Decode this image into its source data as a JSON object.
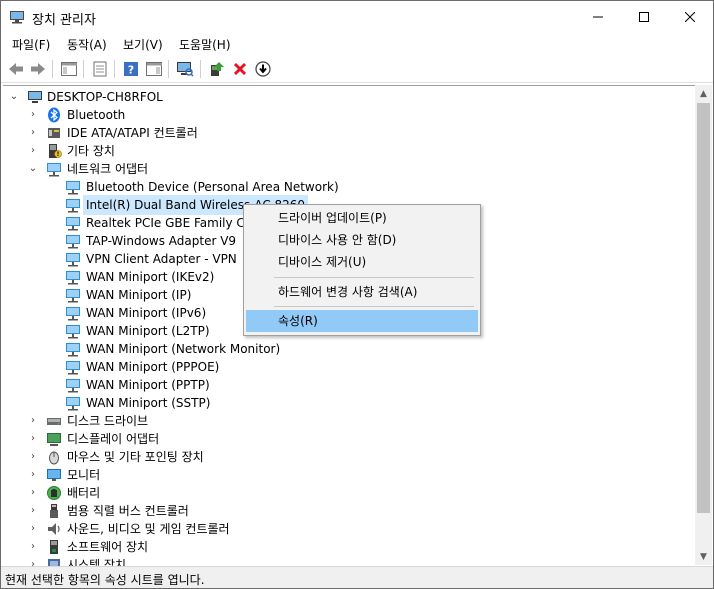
{
  "window": {
    "title": "장치 관리자",
    "app_icon": "device-manager-icon"
  },
  "menu": [
    "파일(F)",
    "동작(A)",
    "보기(V)",
    "도움말(H)"
  ],
  "toolbar": {
    "icons": [
      "back-arrow-icon",
      "forward-arrow-icon",
      "show-hide-tree-icon",
      "properties-sheet-icon",
      "help-icon",
      "action-pane-icon",
      "scan-hardware-icon",
      "update-driver-icon",
      "uninstall-device-icon",
      "download-driver-icon"
    ]
  },
  "tree": {
    "root": "DESKTOP-CH8RFOL",
    "bluetooth": "Bluetooth",
    "ide": "IDE ATA/ATAPI 컨트롤러",
    "other": "기타 장치",
    "network": "네트워크 어댑터",
    "net_children": [
      "Bluetooth Device (Personal Area Network)",
      "Intel(R) Dual Band Wireless-AC 8260",
      "Realtek PCIe GBE Family Controller",
      "TAP-Windows Adapter V9",
      "VPN Client Adapter - VPN",
      "WAN Miniport (IKEv2)",
      "WAN Miniport (IP)",
      "WAN Miniport (IPv6)",
      "WAN Miniport (L2TP)",
      "WAN Miniport (Network Monitor)",
      "WAN Miniport (PPPOE)",
      "WAN Miniport (PPTP)",
      "WAN Miniport (SSTP)"
    ],
    "categories": [
      "디스크 드라이브",
      "디스플레이 어댑터",
      "마우스 및 기타 포인팅 장치",
      "모니터",
      "배터리",
      "범용 직렬 버스 컨트롤러",
      "사운드, 비디오 및 게임 컨트롤러",
      "소프트웨어 장치",
      "시스템 장치"
    ]
  },
  "context_menu": {
    "update_driver": "드라이버 업데이트(P)",
    "disable_device": "디바이스 사용 안 함(D)",
    "uninstall_device": "디바이스 제거(U)",
    "scan_hardware": "하드웨어 변경 사항 검색(A)",
    "properties": "속성(R)"
  },
  "status": "현재 선택한 항목의 속성 시트를 엽니다.",
  "colors": {
    "selection": "#cce8ff",
    "menu_highlight": "#91c9f7",
    "error_red": "#e81123",
    "net_icon": "#2b8fd6"
  }
}
